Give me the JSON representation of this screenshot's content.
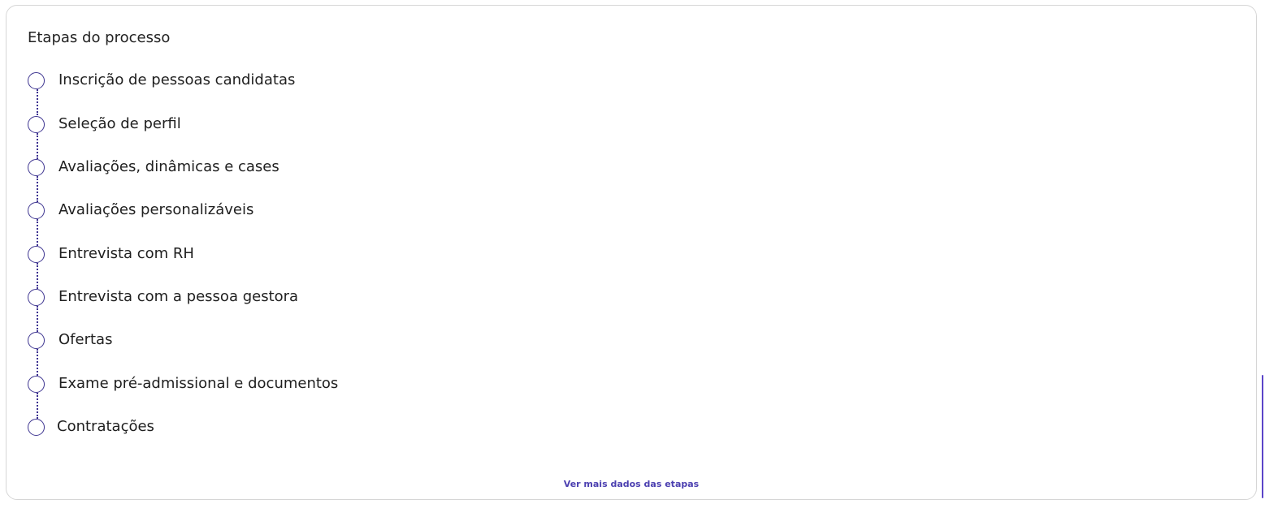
{
  "card": {
    "title": "Etapas do processo",
    "steps": [
      {
        "label": "Inscrição de pessoas candidatas"
      },
      {
        "label": "Seleção de perfil"
      },
      {
        "label": "Avaliações, dinâmicas e cases"
      },
      {
        "label": "Avaliações personalizáveis"
      },
      {
        "label": "Entrevista com RH"
      },
      {
        "label": "Entrevista com a pessoa gestora"
      },
      {
        "label": "Ofertas"
      },
      {
        "label": "Exame pré-admissional e documentos"
      },
      {
        "label": "Contratações"
      }
    ],
    "more_link": "Ver mais dados das etapas"
  },
  "colors": {
    "accent": "#3d3490",
    "link": "#4b3fb0",
    "border": "#d6d6d6"
  }
}
